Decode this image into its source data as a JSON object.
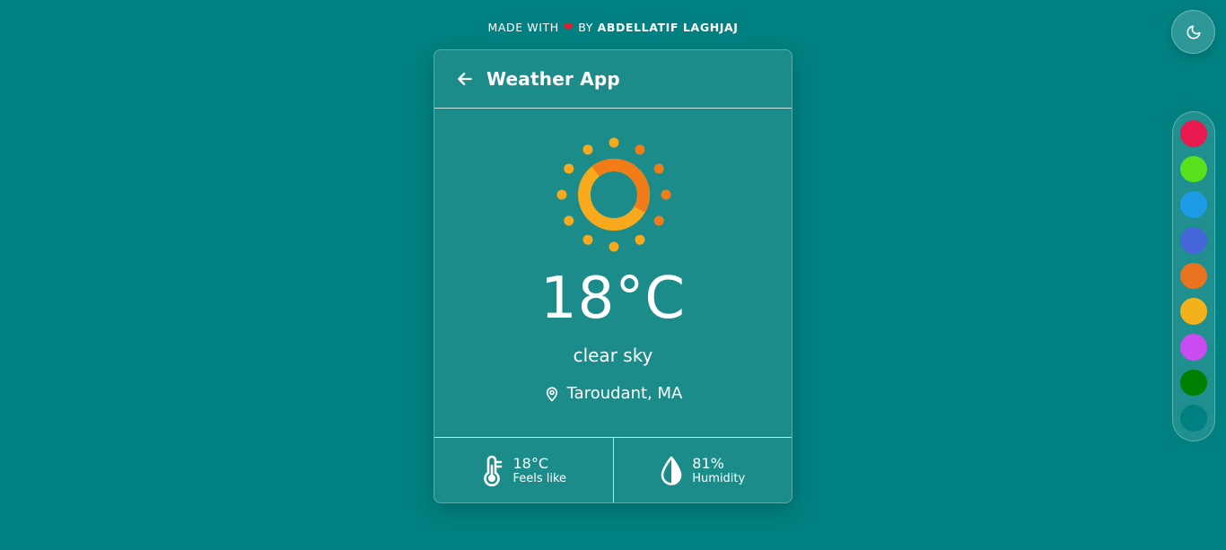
{
  "credit": {
    "prefix": "MADE WITH",
    "heart": "❤",
    "by": "BY",
    "author": "ABDELLATIF LAGHJAJ"
  },
  "theme_toggle": {
    "icon": "moon-icon"
  },
  "palette": {
    "colors": [
      "#e8194f",
      "#5ae11e",
      "#1e9be6",
      "#4466d8",
      "#ea7320",
      "#f3b21a",
      "#c84cf0",
      "#008000",
      "#008080"
    ]
  },
  "card": {
    "header": {
      "title": "Weather App",
      "back_icon": "arrow-left-icon"
    },
    "weather": {
      "icon": "sun-icon",
      "temperature": "18°C",
      "description": "clear sky",
      "location_icon": "map-pin-icon",
      "location": "Taroudant, MA"
    },
    "stats": {
      "feels_like": {
        "icon": "thermometer-icon",
        "value": "18°C",
        "label": "Feels like"
      },
      "humidity": {
        "icon": "droplet-icon",
        "value": "81%",
        "label": "Humidity"
      }
    }
  }
}
